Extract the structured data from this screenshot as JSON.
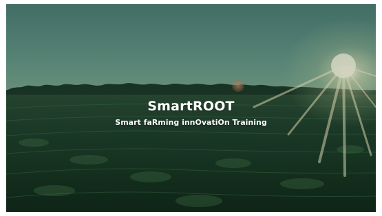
{
  "slide": {
    "title": "SmartROOT",
    "subtitle": "Smart faRming innOvatiOn Training"
  },
  "colors": {
    "text": "#ffffff",
    "sky": "#5b8b80",
    "field": "#1f3d2a",
    "sun": "#fffadc"
  }
}
